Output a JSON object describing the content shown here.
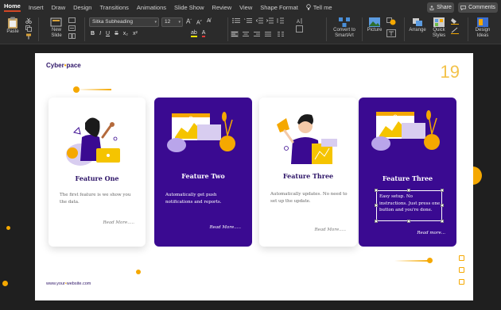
{
  "menu": {
    "items": [
      "Home",
      "Insert",
      "Draw",
      "Design",
      "Transitions",
      "Animations",
      "Slide Show",
      "Review",
      "View",
      "Shape Format"
    ],
    "tell_me": "Tell me",
    "share": "Share",
    "comments": "Comments"
  },
  "ribbon": {
    "paste": "Paste",
    "new_slide": "New\nSlide",
    "font_name": "Sitka Subheading",
    "font_size": "12",
    "convert": "Convert to\nSmartArt",
    "picture": "Picture",
    "arrange": "Arrange",
    "quick_styles": "Quick\nStyles",
    "design_ideas": "Design\nIdeas",
    "bold": "B",
    "italic": "I",
    "underline": "U",
    "strike": "S",
    "font_color_label": "A"
  },
  "slide": {
    "logo_pre": "Cyber",
    "logo_post": "pace",
    "number": "19",
    "website_pre": "www.your",
    "website_post": "website.com",
    "cards": [
      {
        "title": "Feature One",
        "desc": "The first feature is we show you the data.",
        "more": "Read More....."
      },
      {
        "title": "Feature Two",
        "desc": "Automatically get push notifications and reports.",
        "more": "Read More....."
      },
      {
        "title": "Feature Three",
        "desc": "Automatically updates. No need to set up the update.",
        "more": "Read More....."
      },
      {
        "title": "Feature Three",
        "desc": "Easy setup. No instructions. Just press one button and you're done.",
        "more": "Read more..."
      }
    ]
  },
  "colors": {
    "purple": "#3a0a91",
    "orange": "#f5a800",
    "navy": "#2d1467"
  }
}
